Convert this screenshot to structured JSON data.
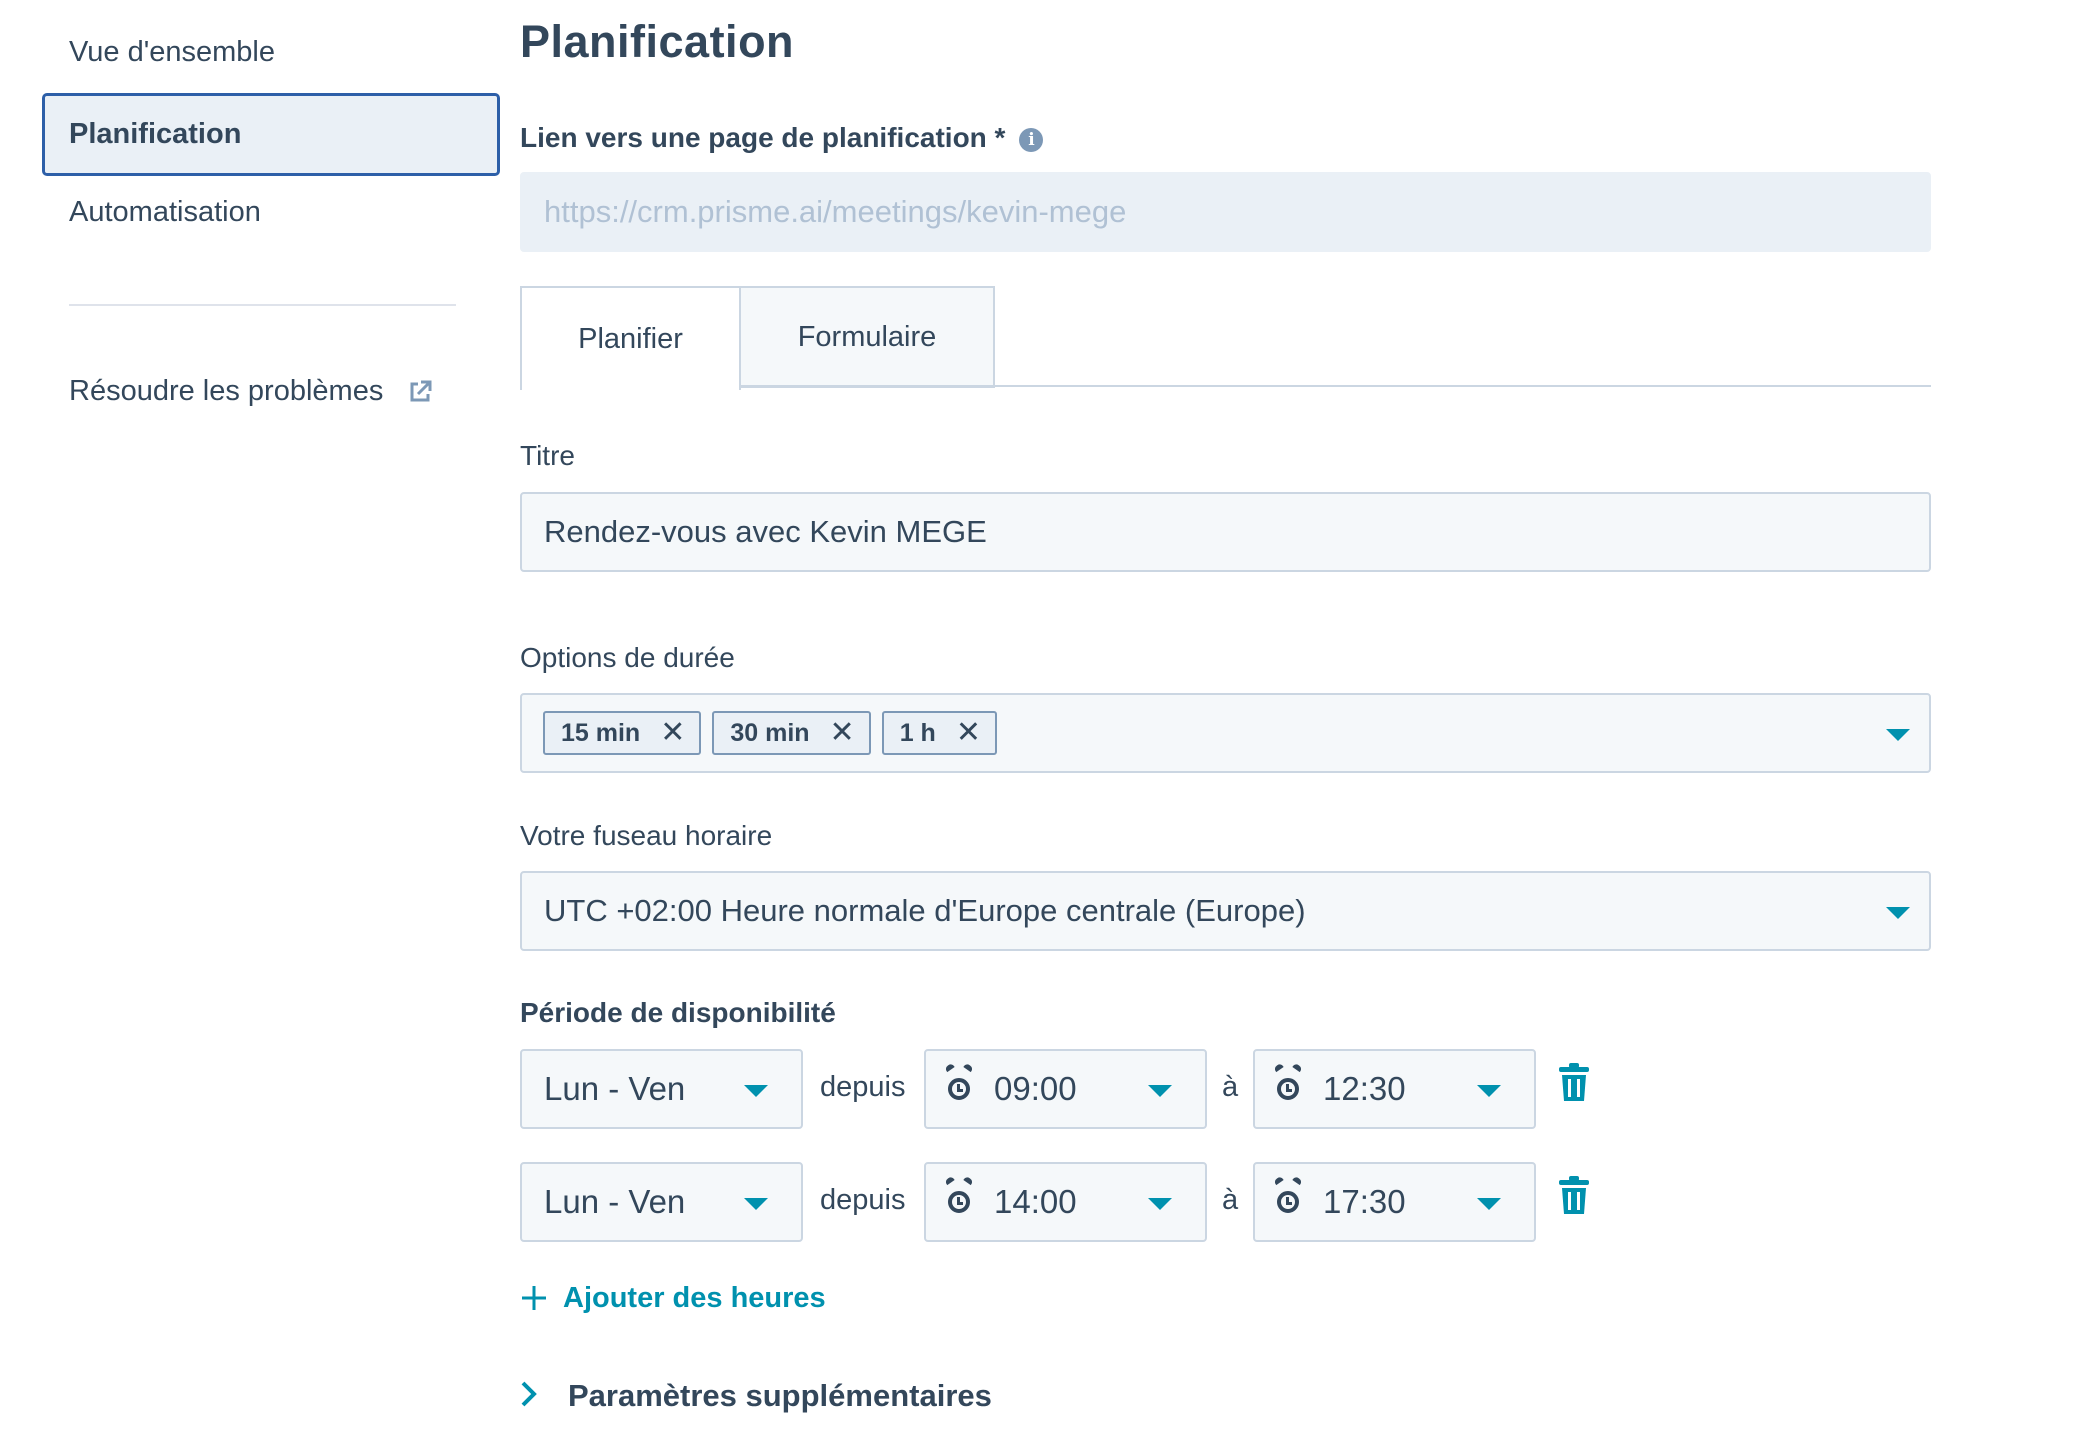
{
  "sidebar": {
    "items": [
      {
        "label": "Vue d'ensemble"
      },
      {
        "label": "Planification"
      },
      {
        "label": "Automatisation"
      }
    ],
    "troubleshoot": {
      "label": "Résoudre les problèmes",
      "icon": "external-link-icon"
    }
  },
  "main": {
    "title": "Planification",
    "link": {
      "label": "Lien vers une page de planification *",
      "info_icon": "info-icon",
      "value": "https://crm.prisme.ai/meetings/kevin-mege"
    },
    "tabs": [
      {
        "label": "Planifier",
        "active": true
      },
      {
        "label": "Formulaire",
        "active": false
      }
    ],
    "title_field": {
      "label": "Titre",
      "value": "Rendez-vous avec Kevin MEGE"
    },
    "duration": {
      "label": "Options de durée",
      "tags": [
        "15 min",
        "30 min",
        "1 h"
      ],
      "remove_icon": "close-icon",
      "dropdown_icon": "caret-down-icon"
    },
    "timezone": {
      "label": "Votre fuseau horaire",
      "value": "UTC +02:00 Heure normale d'Europe centrale (Europe)"
    },
    "availability": {
      "label": "Période de disponibilité",
      "from_word": "depuis",
      "to_word": "à",
      "rows": [
        {
          "days": "Lun - Ven",
          "start": "09:00",
          "end": "12:30"
        },
        {
          "days": "Lun - Ven",
          "start": "14:00",
          "end": "17:30"
        }
      ],
      "add_label": "Ajouter des heures"
    },
    "more_settings": {
      "label": "Paramètres supplémentaires"
    }
  },
  "colors": {
    "accent": "#0091ae",
    "text": "#33475b",
    "active_border": "#2d5fa8",
    "field_bg": "#f5f8fa",
    "border": "#cbd6e2"
  }
}
